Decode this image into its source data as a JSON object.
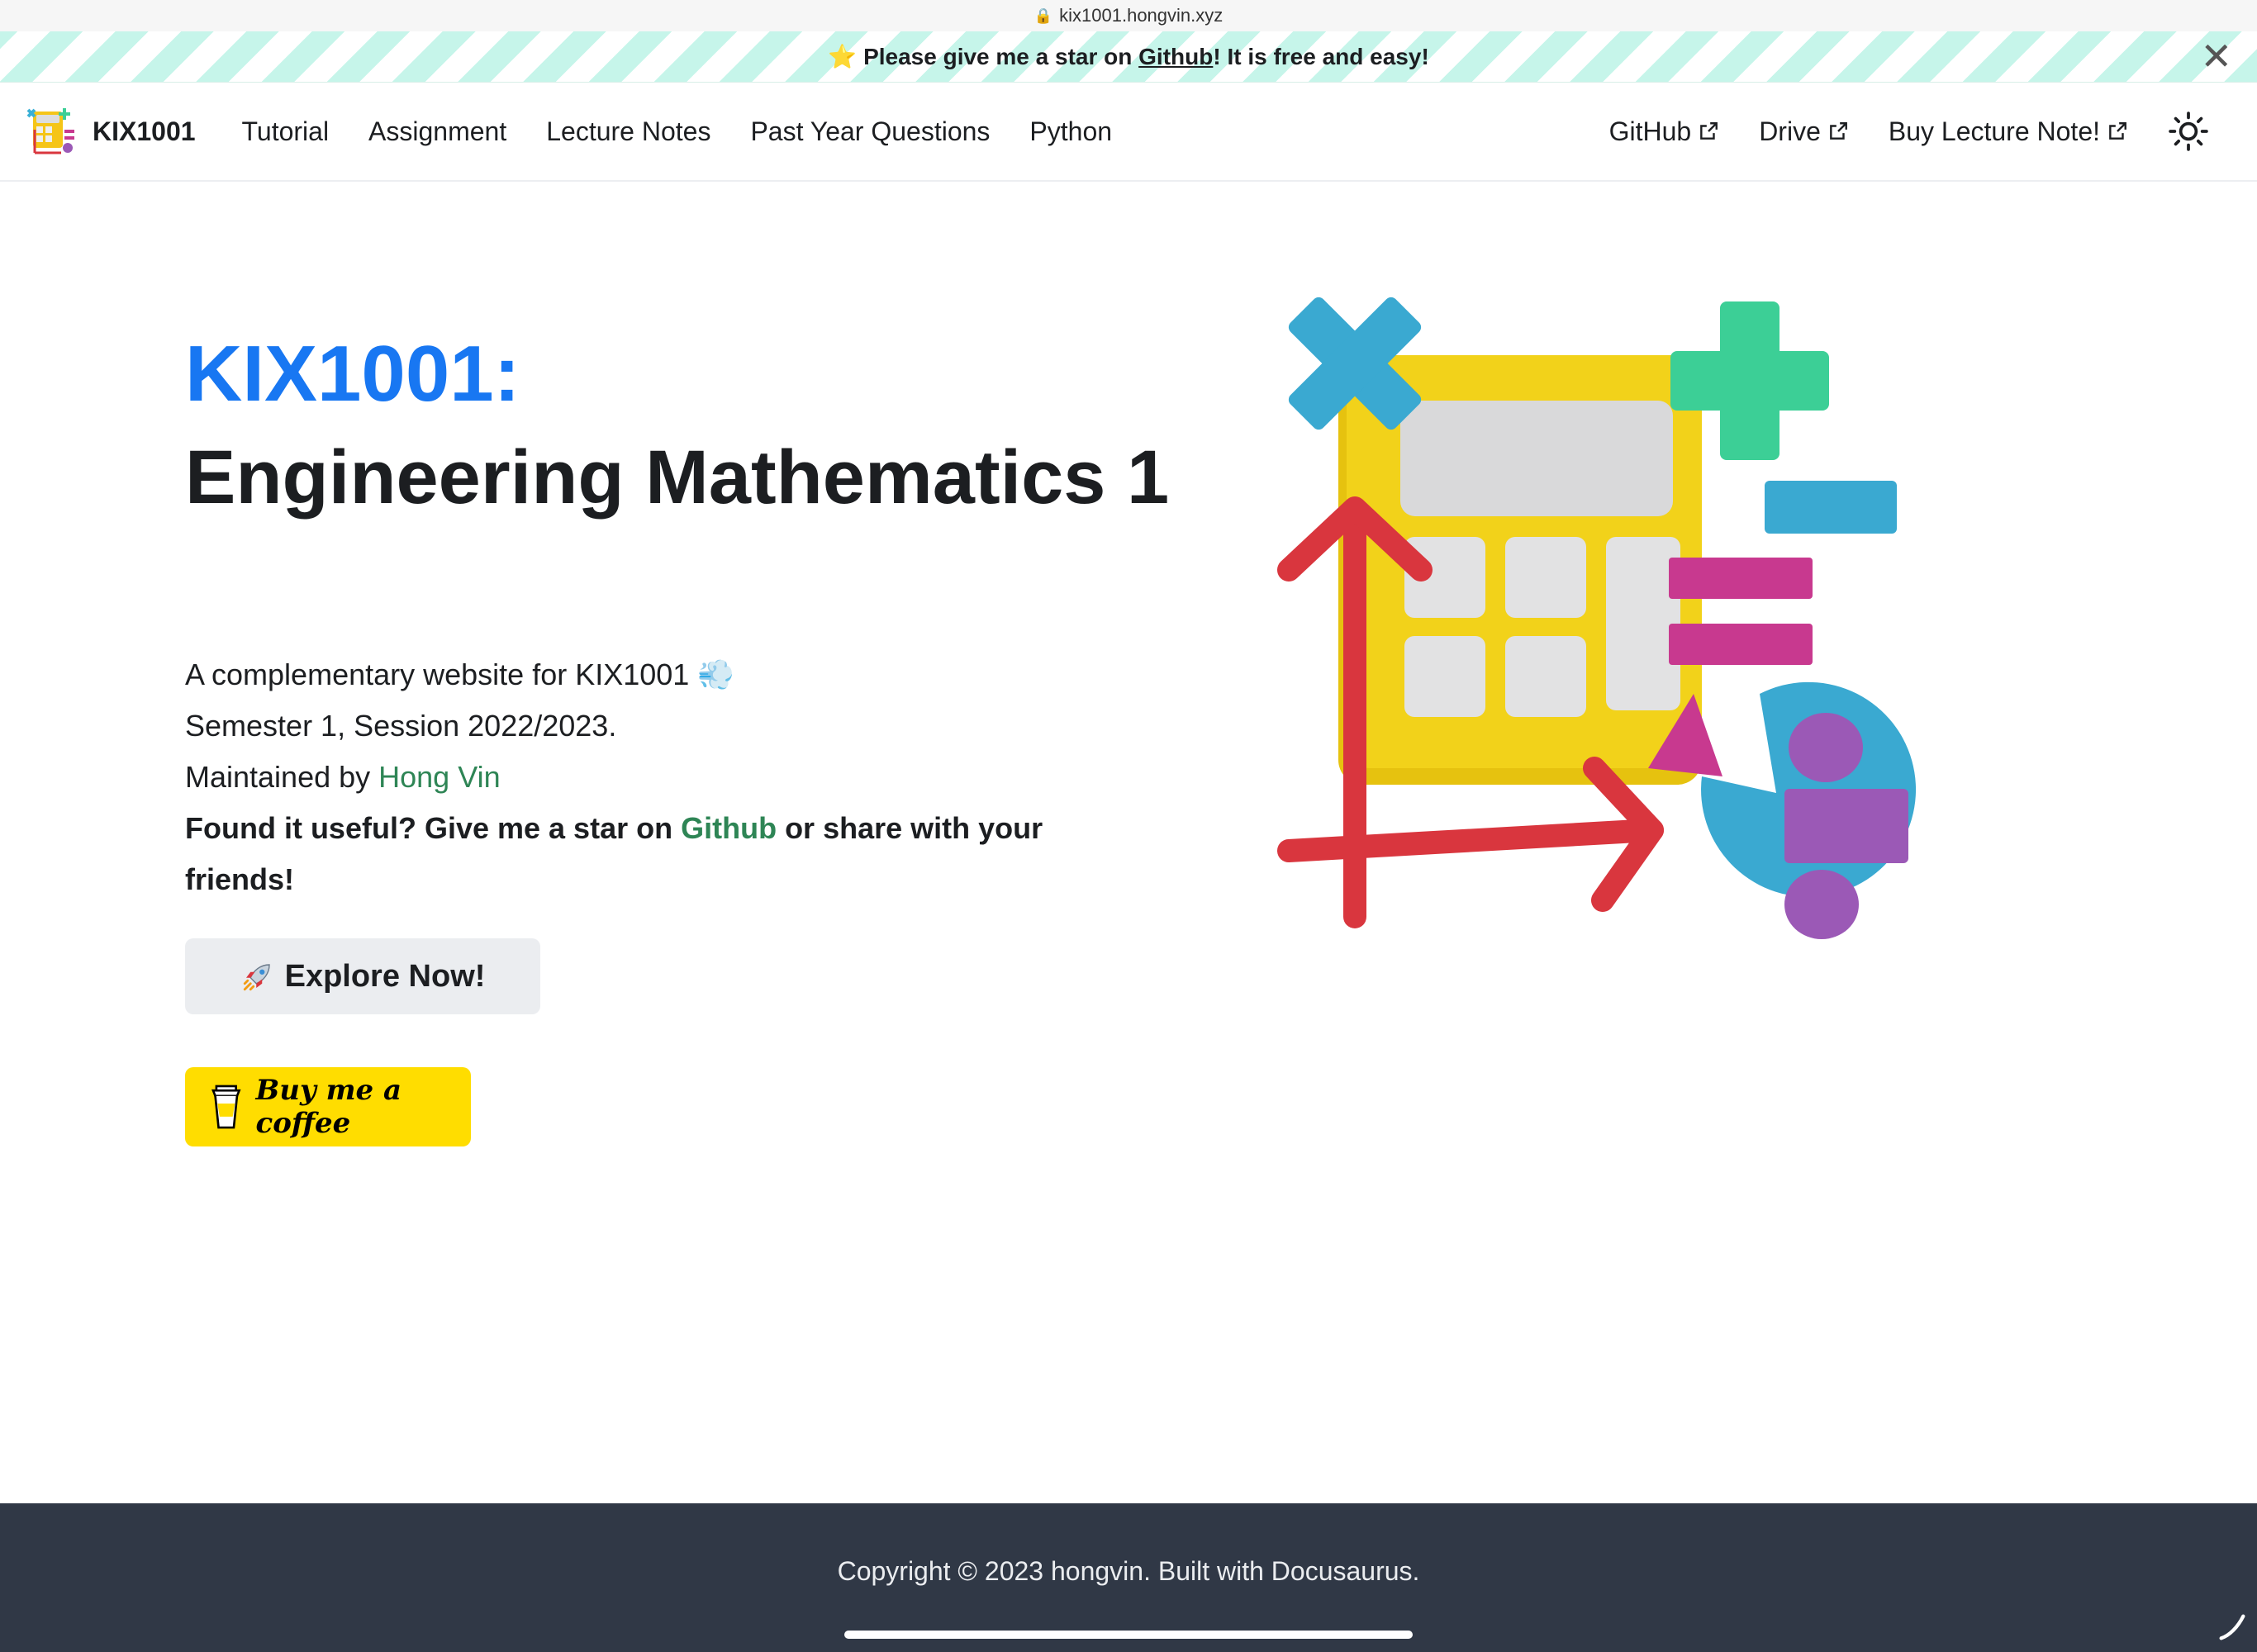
{
  "browser": {
    "url": "kix1001.hongvin.xyz"
  },
  "announcement": {
    "prefix": "Please give me a star on ",
    "link": "Github",
    "suffix": "! It is free and easy!",
    "close": "✕"
  },
  "navbar": {
    "brand": "KIX1001",
    "items": [
      "Tutorial",
      "Assignment",
      "Lecture Notes",
      "Past Year Questions",
      "Python"
    ],
    "external": [
      "GitHub",
      "Drive",
      "Buy Lecture Note!"
    ]
  },
  "hero": {
    "accent_title": "KIX1001:",
    "title": "Engineering Mathematics 1",
    "desc_line1": "A complementary website for KIX1001",
    "desc_line2": "Semester 1, Session 2022/2023.",
    "maintained_prefix": "Maintained by ",
    "maintainer": "Hong Vin",
    "cta_prefix": "Found it useful? Give me a star on ",
    "cta_link": "Github",
    "cta_suffix": " or share with your friends!",
    "explore_label": "Explore Now!",
    "coffee_label": "Buy me a coffee"
  },
  "footer": {
    "copyright": "Copyright © 2023 hongvin. Built with Docusaurus."
  },
  "colors": {
    "accent": "#1877f2",
    "link": "#2e8555",
    "coffee": "#ffdd00",
    "footer": "#303846"
  }
}
